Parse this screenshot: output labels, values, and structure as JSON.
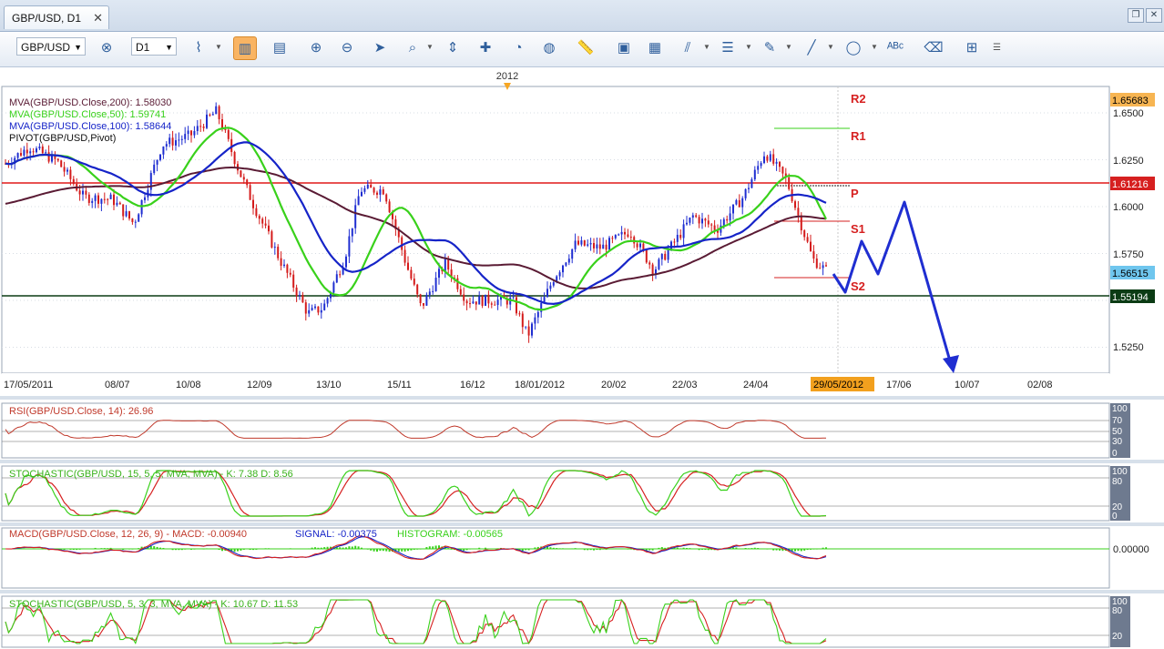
{
  "tab": {
    "title": "GBP/USD, D1",
    "close": "✕"
  },
  "toolbar": {
    "symbol": "GBP/USD",
    "timeframe": "D1",
    "buttons": [
      "bar-style",
      "bar-chart",
      "candles",
      "line",
      "zoom-in",
      "zoom-out",
      "cursor",
      "zoom-area",
      "autoscale",
      "crosshair",
      "globe",
      "ruler",
      "picture",
      "template",
      "trend",
      "fibonacci",
      "pen",
      "line-tool",
      "ellipse",
      "text",
      "eraser",
      "tree"
    ]
  },
  "main": {
    "year_label": "2012",
    "legend": [
      {
        "text": "MVA(GBP/USD.Close,200): 1.58030",
        "color": "#5a1b34"
      },
      {
        "text": "MVA(GBP/USD.Close,50): 1.59741",
        "color": "#39d11b"
      },
      {
        "text": "MVA(GBP/USD.Close,100): 1.58644",
        "color": "#1624c8"
      },
      {
        "text": "PIVOT(GBP/USD,Pivot)",
        "color": "#111111"
      }
    ],
    "pivot_labels": [
      "R2",
      "R1",
      "P",
      "S1",
      "S2"
    ],
    "price_ticks": [
      "1.6500",
      "1.6250",
      "1.6000",
      "1.5750",
      "1.5250"
    ],
    "price_flags": [
      {
        "text": "1.65683",
        "bg": "#f7b552",
        "fg": "#000000"
      },
      {
        "text": "1.61216",
        "bg": "#d62020",
        "fg": "#ffffff"
      },
      {
        "text": "1.56515",
        "bg": "#6fc6ee",
        "fg": "#000000"
      },
      {
        "text": "1.55194",
        "bg": "#0b3b14",
        "fg": "#ffffff"
      }
    ],
    "date_ticks": [
      "17/05/2011",
      "08/07",
      "10/08",
      "12/09",
      "13/10",
      "15/11",
      "16/12",
      "18/01/2012",
      "20/02",
      "22/03",
      "24/04",
      "17/06",
      "10/07",
      "02/08"
    ],
    "cursor_date": "29/05/2012"
  },
  "panels": {
    "rsi": {
      "label": "RSI(GBP/USD.Close, 14): 26.96",
      "color": "#c0392b",
      "ticks": [
        "100",
        "70",
        "50",
        "30",
        "0"
      ]
    },
    "stoch1": {
      "label": "STOCHASTIC(GBP/USD, 15, 5, 5, MVA, MVA) -  K: 7.38  D: 8.56",
      "color": "#39b21b",
      "ticks": [
        "100",
        "80",
        "20",
        "0"
      ]
    },
    "macd": {
      "label_main": "MACD(GBP/USD.Close, 12, 26, 9) -  MACD: -0.00940",
      "label_signal": "SIGNAL: -0.00375",
      "label_hist": "HISTOGRAM: -0.00565",
      "colors": [
        "#c0392b",
        "#1624c8",
        "#39d11b"
      ],
      "ticks": [
        "0.00000"
      ]
    },
    "stoch2": {
      "label": "STOCHASTIC(GBP/USD, 5, 3, 3, MVA, MVA) -  K: 10.67  D: 11.53",
      "color": "#39b21b",
      "ticks": [
        "100",
        "80",
        "20"
      ]
    }
  },
  "chart_data": {
    "type": "candlestick",
    "symbol": "GBP/USD",
    "timeframe": "D1",
    "ylim": [
      1.515,
      1.66
    ],
    "levels": {
      "R1": 1.6415,
      "P": 1.6122,
      "S1": 1.593,
      "S2": 1.5635,
      "support": 1.55194
    },
    "close_path": [
      [
        "2011-05-17",
        1.623
      ],
      [
        "2011-05-28",
        1.632
      ],
      [
        "2011-06-10",
        1.624
      ],
      [
        "2011-06-22",
        1.605
      ],
      [
        "2011-07-05",
        1.604
      ],
      [
        "2011-07-15",
        1.591
      ],
      [
        "2011-07-28",
        1.633
      ],
      [
        "2011-08-10",
        1.638
      ],
      [
        "2011-08-22",
        1.651
      ],
      [
        "2011-09-01",
        1.62
      ],
      [
        "2011-09-08",
        1.601
      ],
      [
        "2011-09-20",
        1.572
      ],
      [
        "2011-10-03",
        1.543
      ],
      [
        "2011-10-10",
        1.546
      ],
      [
        "2011-10-20",
        1.573
      ],
      [
        "2011-10-27",
        1.609
      ],
      [
        "2011-11-07",
        1.609
      ],
      [
        "2011-11-17",
        1.57
      ],
      [
        "2011-11-24",
        1.546
      ],
      [
        "2011-12-05",
        1.57
      ],
      [
        "2011-12-15",
        1.55
      ],
      [
        "2012-01-05",
        1.55
      ],
      [
        "2012-01-12",
        1.531
      ],
      [
        "2012-01-24",
        1.562
      ],
      [
        "2012-02-03",
        1.58
      ],
      [
        "2012-02-15",
        1.578
      ],
      [
        "2012-02-28",
        1.587
      ],
      [
        "2012-03-10",
        1.566
      ],
      [
        "2012-03-20",
        1.582
      ],
      [
        "2012-03-28",
        1.595
      ],
      [
        "2012-04-08",
        1.588
      ],
      [
        "2012-04-20",
        1.605
      ],
      [
        "2012-04-30",
        1.629
      ],
      [
        "2012-05-10",
        1.614
      ],
      [
        "2012-05-22",
        1.572
      ],
      [
        "2012-05-29",
        1.5651
      ]
    ],
    "moving_averages": [
      {
        "name": "MVA(200)",
        "last": 1.5803
      },
      {
        "name": "MVA(50)",
        "last": 1.59741
      },
      {
        "name": "MVA(100)",
        "last": 1.58644
      }
    ],
    "forecast_path": [
      [
        "2012-05-29",
        1.5651
      ],
      [
        "2012-06-02",
        1.555
      ],
      [
        "2012-06-08",
        1.58
      ],
      [
        "2012-06-13",
        1.566
      ],
      [
        "2012-06-19",
        1.602
      ],
      [
        "2012-07-10",
        1.521
      ]
    ],
    "indicators": {
      "rsi": 26.96,
      "stoch_15_5_5": {
        "K": 7.38,
        "D": 8.56
      },
      "macd": {
        "MACD": -0.0094,
        "SIGNAL": -0.00375,
        "HISTOGRAM": -0.00565
      },
      "stoch_5_3_3": {
        "K": 10.67,
        "D": 11.53
      }
    }
  }
}
